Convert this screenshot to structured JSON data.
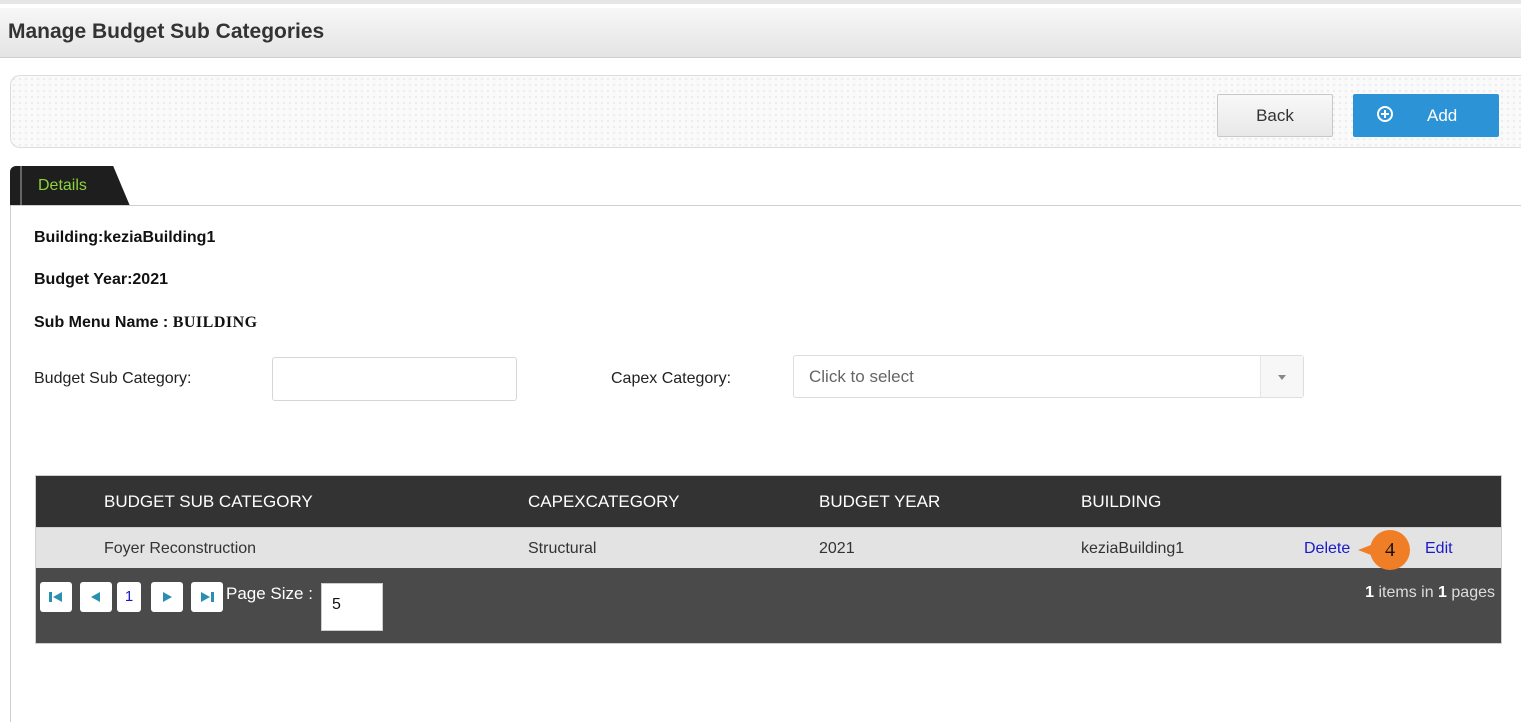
{
  "page": {
    "title": "Manage Budget Sub Categories"
  },
  "toolbar": {
    "back_label": "Back",
    "add_label": "Add"
  },
  "tabs": [
    {
      "label": "Details"
    }
  ],
  "info": {
    "building_label": "Building:",
    "building_value": "keziaBuilding1",
    "budget_year_label": "Budget Year:",
    "budget_year_value": "2021",
    "sub_menu_label": "Sub Menu Name : ",
    "sub_menu_value": "BUILDING"
  },
  "filters": {
    "budget_sub_category_label": "Budget Sub Category:",
    "budget_sub_category_value": "",
    "capex_category_label": "Capex Category:",
    "capex_category_placeholder": "Click to select"
  },
  "grid": {
    "columns": [
      "BUDGET SUB CATEGORY",
      "CAPEXCATEGORY",
      "BUDGET YEAR",
      "BUILDING"
    ],
    "rows": [
      {
        "budget_sub_category": "Foyer Reconstruction",
        "capex_category": "Structural",
        "budget_year": "2021",
        "building": "keziaBuilding1",
        "delete_label": "Delete",
        "edit_label": "Edit"
      }
    ],
    "annotation": "4",
    "pager": {
      "current_page": "1",
      "page_size_label": "Page Size :",
      "page_size": "5",
      "items_count": "1",
      "items_text": " items in ",
      "pages_count": "1",
      "pages_text": " pages"
    }
  },
  "colors": {
    "accent": "#2b93d6",
    "tab_text": "#8bd43a",
    "grid_header": "#333333",
    "badge": "#f07e26"
  }
}
